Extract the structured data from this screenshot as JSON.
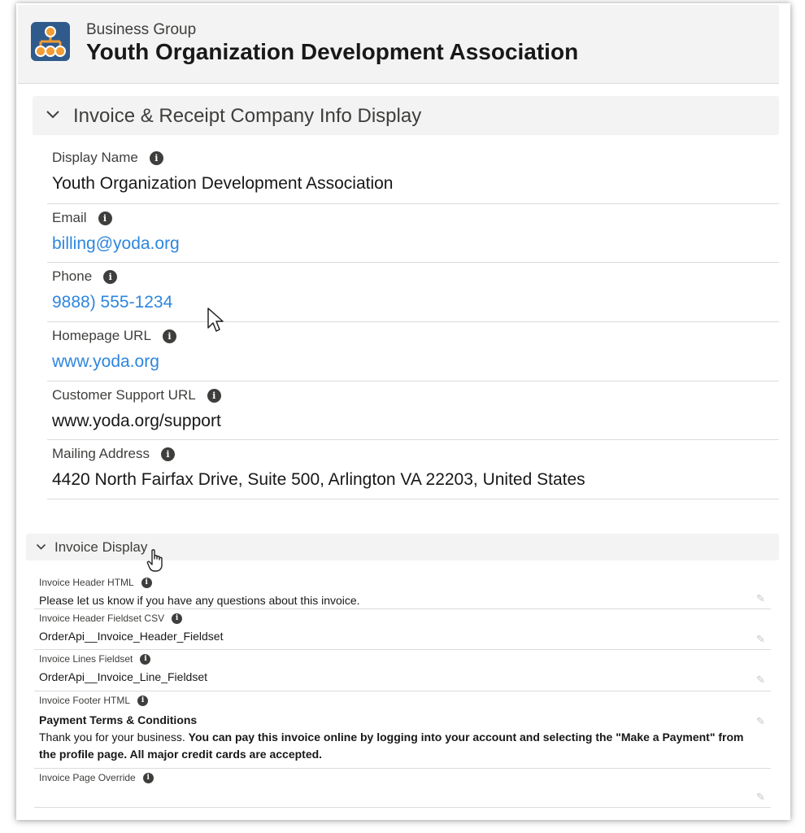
{
  "header": {
    "subtitle": "Business Group",
    "title": "Youth Organization Development Association",
    "icon": "hierarchy-icon",
    "icon_color": "#2f5a8c",
    "icon_accent": "#f39c32"
  },
  "section_company": {
    "title": "Invoice & Receipt Company Info Display",
    "fields": [
      {
        "label": "Display Name",
        "value": "Youth Organization Development Association"
      },
      {
        "label": "Email",
        "value": "billing@yoda.org"
      },
      {
        "label": "Phone",
        "value": "9888) 555-1234"
      },
      {
        "label": "Homepage URL",
        "value": "www.yoda.org"
      },
      {
        "label": "Customer Support URL",
        "value": "www.yoda.org/support"
      },
      {
        "label": "Mailing Address",
        "value": "4420 North Fairfax Drive, Suite 500, Arlington VA 22203, United States"
      }
    ]
  },
  "section_invoice": {
    "title": "Invoice Display",
    "fields": [
      {
        "label": "Invoice Header HTML",
        "value": "Please let us know if you have any questions about this invoice."
      },
      {
        "label": "Invoice Header Fieldset CSV",
        "value": "OrderApi__Invoice_Header_Fieldset"
      },
      {
        "label": "Invoice Lines Fieldset",
        "value": "OrderApi__Invoice_Line_Fieldset"
      },
      {
        "label": "Invoice Footer HTML",
        "footer_heading": "Payment Terms & Conditions",
        "footer_plain": "Thank you for your business. ",
        "footer_bold": "You can pay this invoice online by logging into your account and selecting the \"Make a Payment\" from the profile page. All major credit cards are accepted."
      },
      {
        "label": "Invoice Page Override",
        "value": ""
      }
    ]
  },
  "colors": {
    "link": "#2e86de",
    "section_bg": "#f3f3f3",
    "divider": "#dddbda"
  }
}
